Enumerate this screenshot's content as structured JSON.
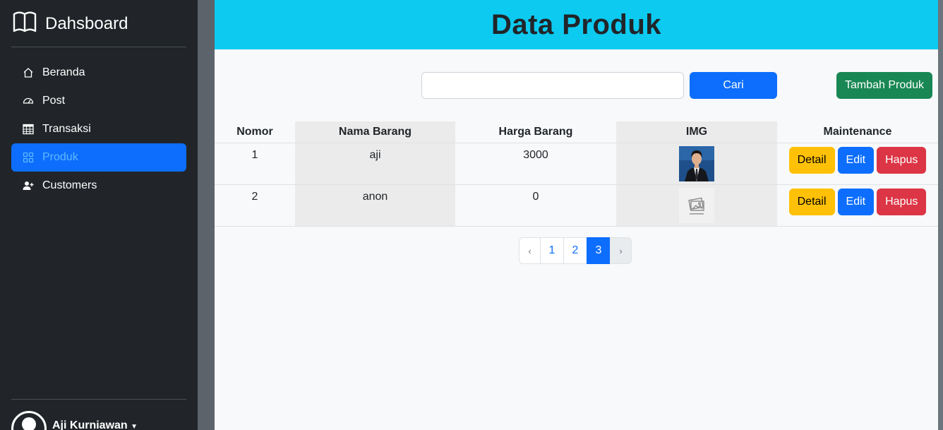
{
  "sidebar": {
    "brand": "Dahsboard",
    "items": [
      {
        "label": "Beranda",
        "icon": "house-icon"
      },
      {
        "label": "Post",
        "icon": "speedometer-icon"
      },
      {
        "label": "Transaksi",
        "icon": "table-icon"
      },
      {
        "label": "Produk",
        "icon": "grid-icon",
        "active": true
      },
      {
        "label": "Customers",
        "icon": "person-add-icon"
      }
    ],
    "user": "Aji Kurniawan"
  },
  "header": {
    "title": "Data Produk"
  },
  "search": {
    "value": "",
    "button": "Cari"
  },
  "add_button": "Tambah Produk",
  "table": {
    "headers": [
      "Nomor",
      "Nama Barang",
      "Harga Barang",
      "IMG",
      "Maintenance"
    ],
    "rows": [
      {
        "nomor": "1",
        "nama": "aji",
        "harga": "3000",
        "img": "photo"
      },
      {
        "nomor": "2",
        "nama": "anon",
        "harga": "0",
        "img": "no-image"
      }
    ],
    "actions": {
      "detail": "Detail",
      "edit": "Edit",
      "hapus": "Hapus"
    }
  },
  "pagination": {
    "prev": "‹",
    "pages": [
      "1",
      "2",
      "3"
    ],
    "active": "3",
    "next": "›"
  },
  "colors": {
    "sidebar": "#212529",
    "header": "#0dcaf0",
    "primary": "#0d6efd",
    "success": "#198754",
    "warning": "#ffc107",
    "danger": "#dc3545"
  }
}
